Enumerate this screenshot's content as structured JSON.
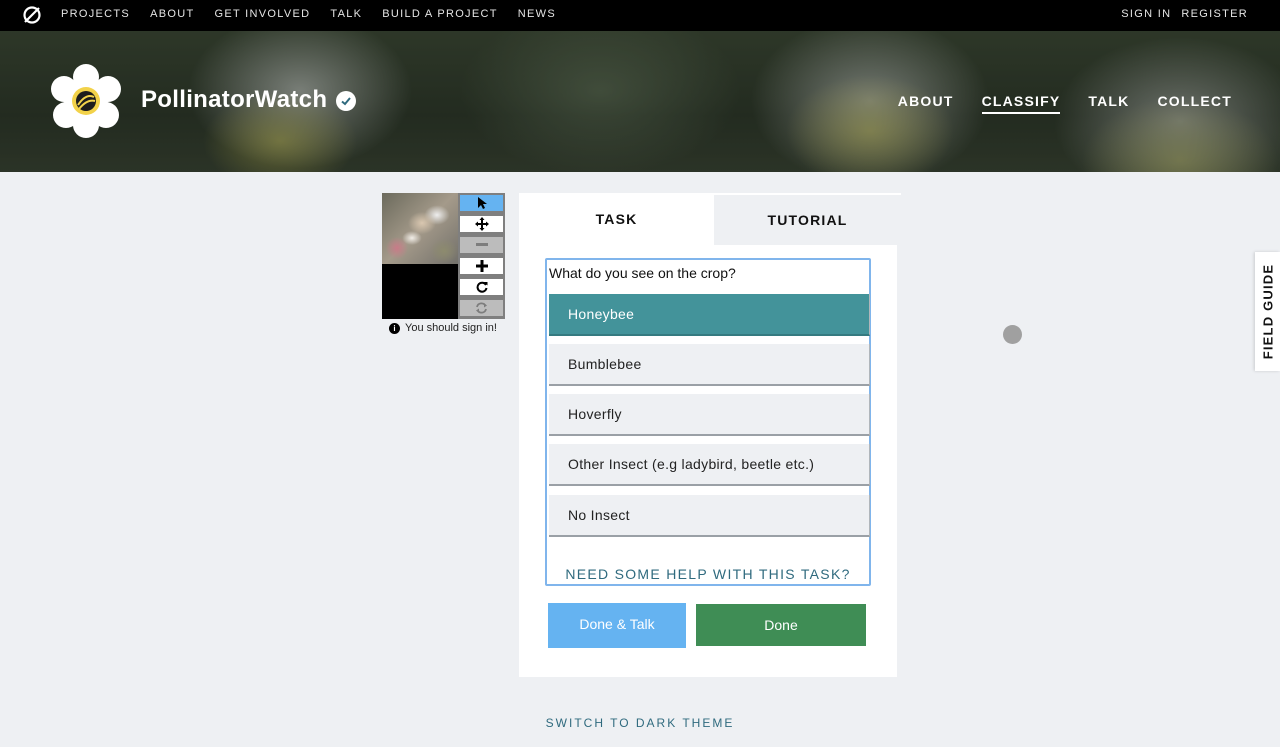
{
  "topnav": {
    "links": [
      "PROJECTS",
      "ABOUT",
      "GET INVOLVED",
      "TALK",
      "BUILD A PROJECT",
      "NEWS"
    ],
    "sign_in": "SIGN IN",
    "register": "REGISTER"
  },
  "project": {
    "title": "PollinatorWatch",
    "nav": [
      "ABOUT",
      "CLASSIFY",
      "TALK",
      "COLLECT"
    ],
    "active_nav": "CLASSIFY"
  },
  "viewer": {
    "tools": [
      "pointer-icon",
      "move-icon",
      "zoom-out-icon",
      "zoom-in-icon",
      "rotate-icon",
      "reset-icon"
    ],
    "signin_note": "You should sign in!"
  },
  "tabs": {
    "task": "TASK",
    "tutorial": "TUTORIAL"
  },
  "task": {
    "question": "What do you see on the crop?",
    "answers": [
      "Honeybee",
      "Bumblebee",
      "Hoverfly",
      "Other Insect (e.g ladybird, beetle etc.)",
      "No Insect"
    ],
    "selected_index": 0,
    "help": "NEED SOME HELP WITH THIS TASK?"
  },
  "buttons": {
    "done_talk": "Done & Talk",
    "done": "Done"
  },
  "field_guide": "FIELD GUIDE",
  "theme_toggle": "SWITCH TO DARK THEME",
  "colors": {
    "accent_blue": "#65b3f1",
    "selected_teal": "#43939a",
    "done_green": "#3f8d55"
  }
}
